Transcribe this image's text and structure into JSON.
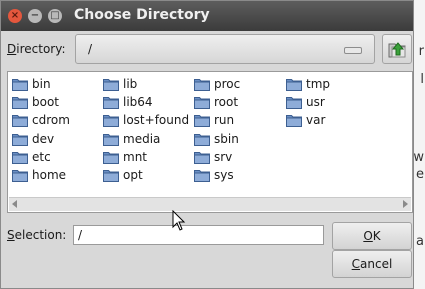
{
  "dialog": {
    "title": "Choose Directory",
    "window_buttons": {
      "close": "×",
      "minimize": "−",
      "maximize": "□"
    }
  },
  "directory": {
    "label_prefix": "",
    "label_access": "D",
    "label_rest": "irectory:",
    "value": "/",
    "up_icon": "folder-up-icon"
  },
  "files": [
    "bin",
    "boot",
    "cdrom",
    "dev",
    "etc",
    "home",
    "lib",
    "lib64",
    "lost+found",
    "media",
    "mnt",
    "opt",
    "proc",
    "root",
    "run",
    "sbin",
    "srv",
    "sys",
    "tmp",
    "usr",
    "var"
  ],
  "selection": {
    "label_prefix": "",
    "label_access": "S",
    "label_rest": "election:",
    "value": "/"
  },
  "buttons": {
    "ok_access": "O",
    "ok_rest": "K",
    "cancel_access": "C",
    "cancel_rest": "ancel"
  },
  "background": {
    "partial_chars": [
      "r",
      "l",
      "w",
      "e",
      "a"
    ]
  },
  "colors": {
    "titlebar": "#4a4a4a",
    "folder": "#6b8fc4",
    "close_button": "#e4573d"
  }
}
